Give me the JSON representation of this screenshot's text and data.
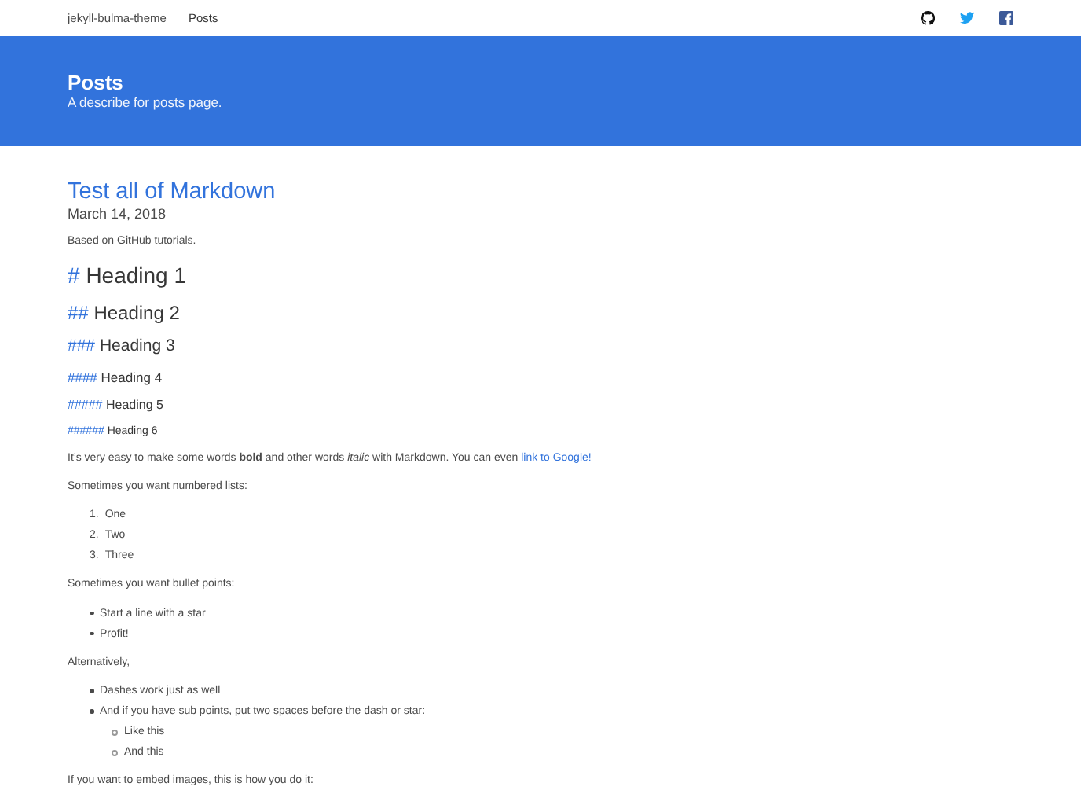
{
  "navbar": {
    "brand": "jekyll-bulma-theme",
    "links": [
      {
        "label": "Posts"
      }
    ]
  },
  "hero": {
    "title": "Posts",
    "subtitle": "A describe for posts page."
  },
  "post": {
    "title": "Test all of Markdown",
    "date": "March 14, 2018",
    "blocks": [
      {
        "kind": "paragraph",
        "text": "Based on GitHub tutorials."
      },
      {
        "kind": "h1",
        "marks": "#",
        "text": "Heading 1"
      },
      {
        "kind": "h2",
        "marks": "##",
        "text": "Heading 2"
      },
      {
        "kind": "h3",
        "marks": "###",
        "text": "Heading 3"
      },
      {
        "kind": "h4",
        "marks": "####",
        "text": "Heading 4"
      },
      {
        "kind": "h5",
        "marks": "#####",
        "text": "Heading 5"
      },
      {
        "kind": "h6",
        "marks": "######",
        "text": "Heading 6"
      },
      {
        "kind": "paragraph",
        "text": "It’s very easy to make some words **bold** and other words *italic* with Markdown. You can even",
        "link": "link to Google!"
      },
      {
        "kind": "paragraph",
        "text": "Sometimes you want numbered lists:"
      },
      {
        "kind": "ordered",
        "items": [
          {
            "marker": "1.",
            "text": "One"
          },
          {
            "marker": "2.",
            "text": "Two"
          },
          {
            "marker": "3.",
            "text": "Three"
          }
        ]
      },
      {
        "kind": "paragraph",
        "text": "Sometimes you want bullet points:"
      },
      {
        "kind": "bullets",
        "items": [
          {
            "text": "Start a line with a star"
          },
          {
            "text": "Profit!"
          }
        ]
      },
      {
        "kind": "paragraph",
        "text": "Alternatively,"
      },
      {
        "kind": "bullets",
        "items": [
          {
            "text": "Dashes work just as well"
          },
          {
            "text": "And if you have sub points, put two spaces before the dash or star:",
            "children": [
              {
                "text": "Like this"
              },
              {
                "text": "And this"
              }
            ]
          }
        ]
      },
      {
        "kind": "paragraph",
        "text": "If you want to embed images, this is how you do it:"
      }
    ]
  }
}
